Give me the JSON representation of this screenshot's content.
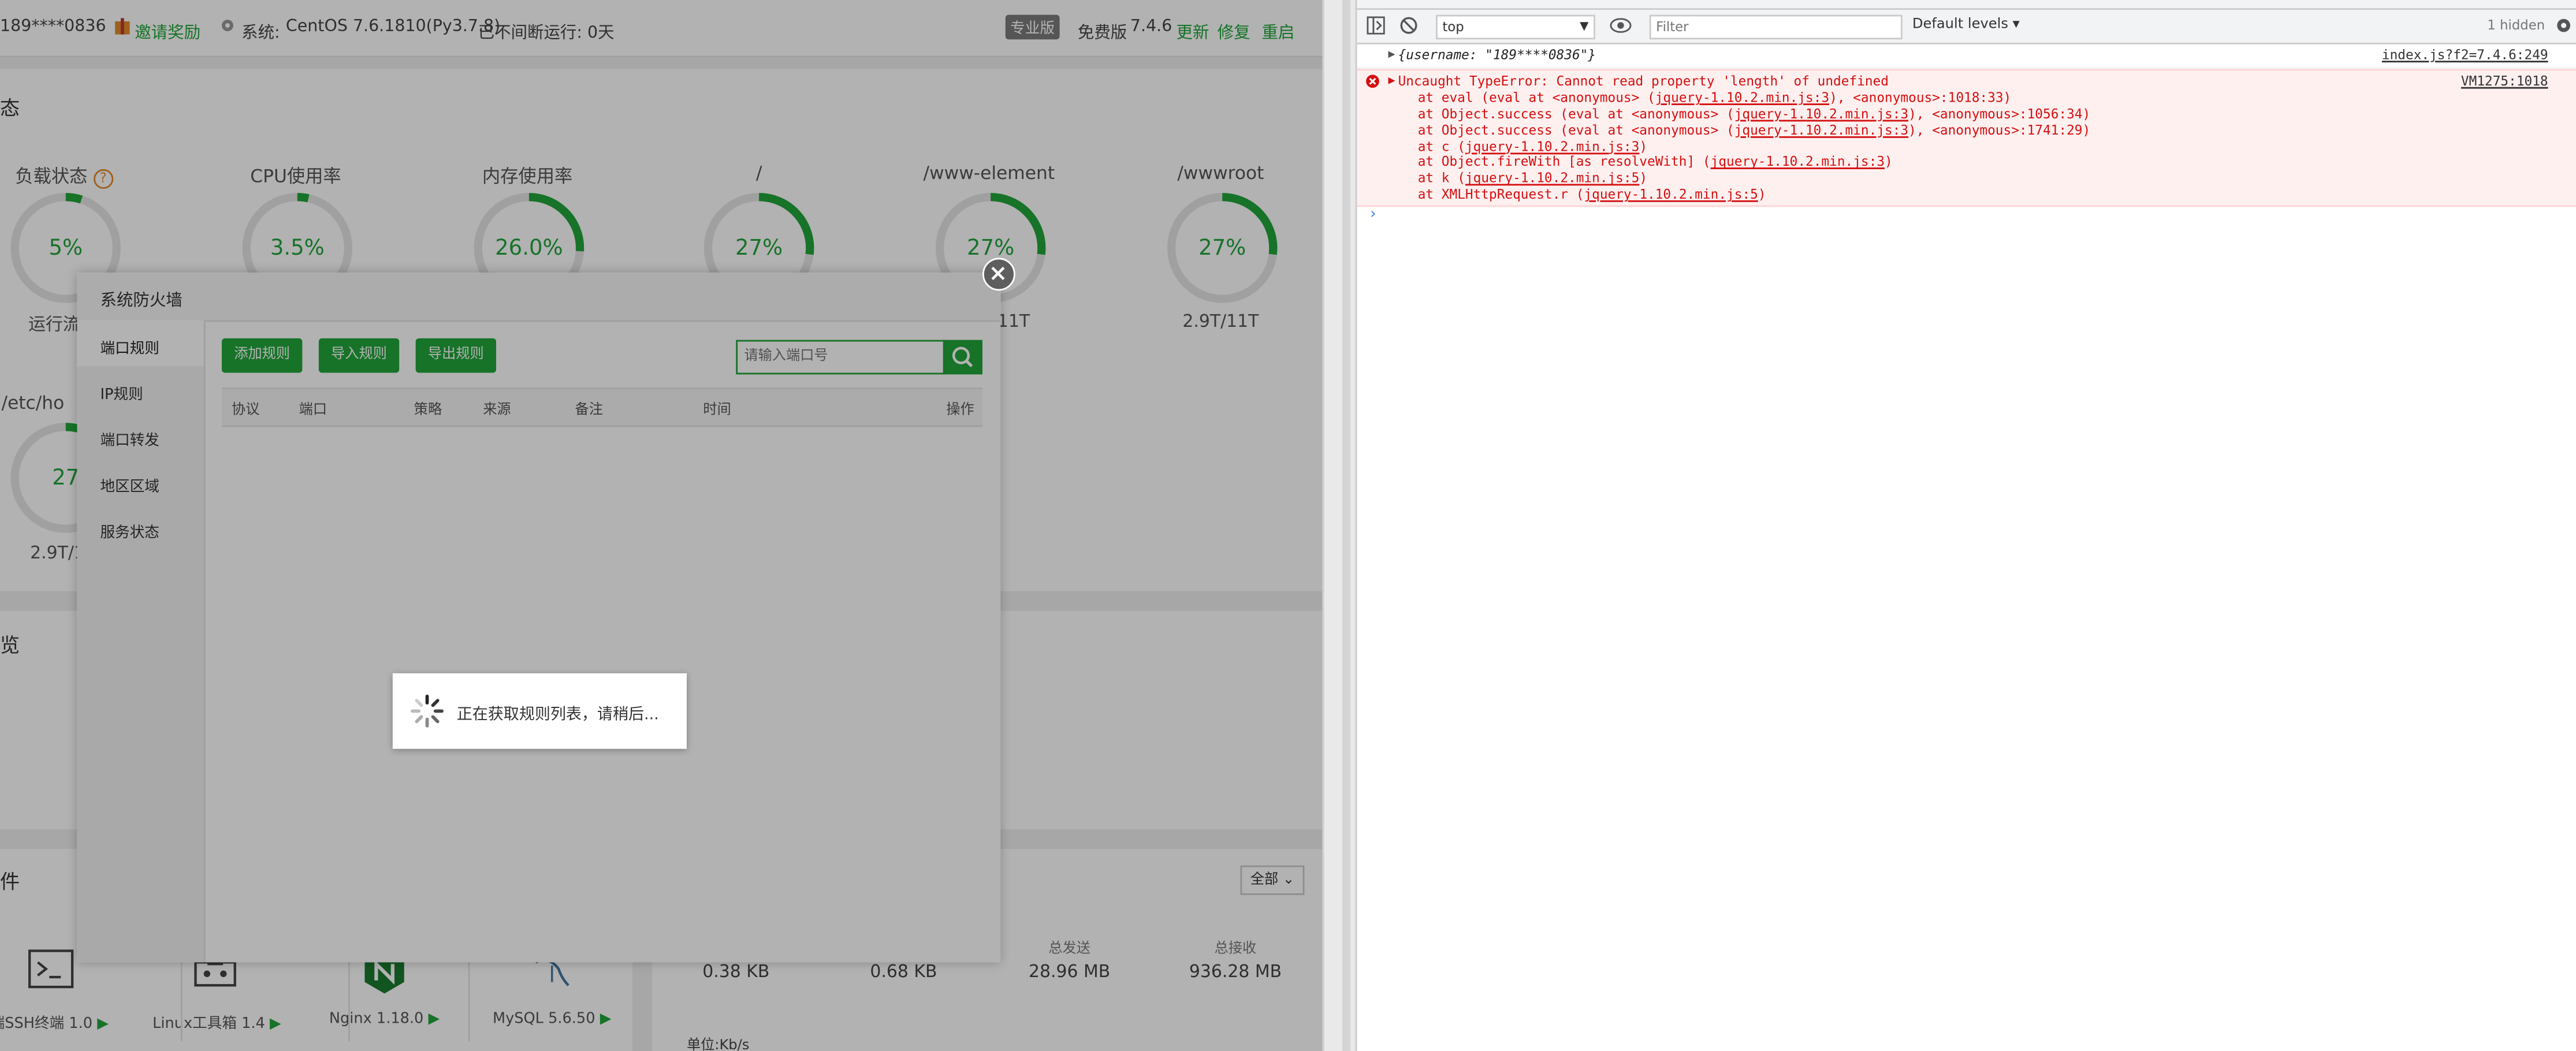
{
  "topbar": {
    "user": "189****0836",
    "invite": "邀请奖励",
    "system_label": "系统:",
    "system_value": "CentOS 7.6.1810(Py3.7.8)",
    "uptime": "已不间断运行: 0天",
    "edition_badge": "专业版",
    "edition": "免费版",
    "version": "7.4.6",
    "update": "更新",
    "repair": "修复",
    "restart": "重启"
  },
  "status": {
    "title": "态",
    "gauges": [
      {
        "label": "负载状态",
        "value": "5%",
        "sub": "运行流",
        "percent": 5
      },
      {
        "label": "CPU使用率",
        "value": "3.5%",
        "sub": "",
        "percent": 3.5
      },
      {
        "label": "内存使用率",
        "value": "26.0%",
        "sub": "",
        "percent": 26
      },
      {
        "label": "/",
        "value": "27%",
        "sub": "",
        "percent": 27
      },
      {
        "label": "/www-element",
        "value": "27%",
        "sub": "11T",
        "percent": 27
      },
      {
        "label": "/wwwroot",
        "value": "27%",
        "sub": "2.9T/11T",
        "percent": 27
      }
    ],
    "row2": {
      "label": "/etc/ho",
      "value": "27",
      "sub": "2.9T/1",
      "percent": 27
    }
  },
  "overview": {
    "title": "览"
  },
  "software": {
    "title": "件",
    "filter": "全部",
    "items": [
      "端SSH终端 1.0",
      "Linux工具箱 1.4",
      "Nginx 1.18.0",
      "MySQL 5.6.50"
    ]
  },
  "network": {
    "stats": [
      {
        "label": "",
        "value": "0.38 KB"
      },
      {
        "label": "",
        "value": "0.68 KB"
      },
      {
        "label": "总发送",
        "value": "28.96 MB"
      },
      {
        "label": "总接收",
        "value": "936.28 MB"
      }
    ],
    "unit": "单位:Kb/s"
  },
  "dialog": {
    "title": "系统防火墙",
    "sidebar": [
      "端口规则",
      "IP规则",
      "端口转发",
      "地区区域",
      "服务状态"
    ],
    "buttons": [
      "添加规则",
      "导入规则",
      "导出规则"
    ],
    "search_placeholder": "请输入端口号",
    "columns": [
      "协议",
      "端口",
      "策略",
      "来源",
      "备注",
      "时间",
      "操作"
    ],
    "loading": "正在获取规则列表，请稍后..."
  },
  "devtools": {
    "context": "top",
    "filter_placeholder": "Filter",
    "levels": "Default levels ▾",
    "hidden": "1 hidden",
    "log_object": "{username: \"189****0836\"}",
    "log_source": "index.js?f2=7.4.6:249",
    "error_message": "Uncaught TypeError: Cannot read property 'length' of undefined",
    "error_source": "VM1275:1018",
    "stack": [
      {
        "pre": "at eval (eval at <anonymous> (",
        "link": "jquery-1.10.2.min.js:3",
        "post": "), <anonymous>:1018:33)"
      },
      {
        "pre": "at Object.success (eval at <anonymous> (",
        "link": "jquery-1.10.2.min.js:3",
        "post": "), <anonymous>:1056:34)"
      },
      {
        "pre": "at Object.success (eval at <anonymous> (",
        "link": "jquery-1.10.2.min.js:3",
        "post": "), <anonymous>:1741:29)"
      },
      {
        "pre": "at c (",
        "link": "jquery-1.10.2.min.js:3",
        "post": ")"
      },
      {
        "pre": "at Object.fireWith [as resolveWith] (",
        "link": "jquery-1.10.2.min.js:3",
        "post": ")"
      },
      {
        "pre": "at k (",
        "link": "jquery-1.10.2.min.js:5",
        "post": ")"
      },
      {
        "pre": "at XMLHttpRequest.r (",
        "link": "jquery-1.10.2.min.js:5",
        "post": ")"
      }
    ],
    "prompt": "›"
  },
  "colors": {
    "accent": "#20a53a",
    "error": "#d40f0f"
  }
}
